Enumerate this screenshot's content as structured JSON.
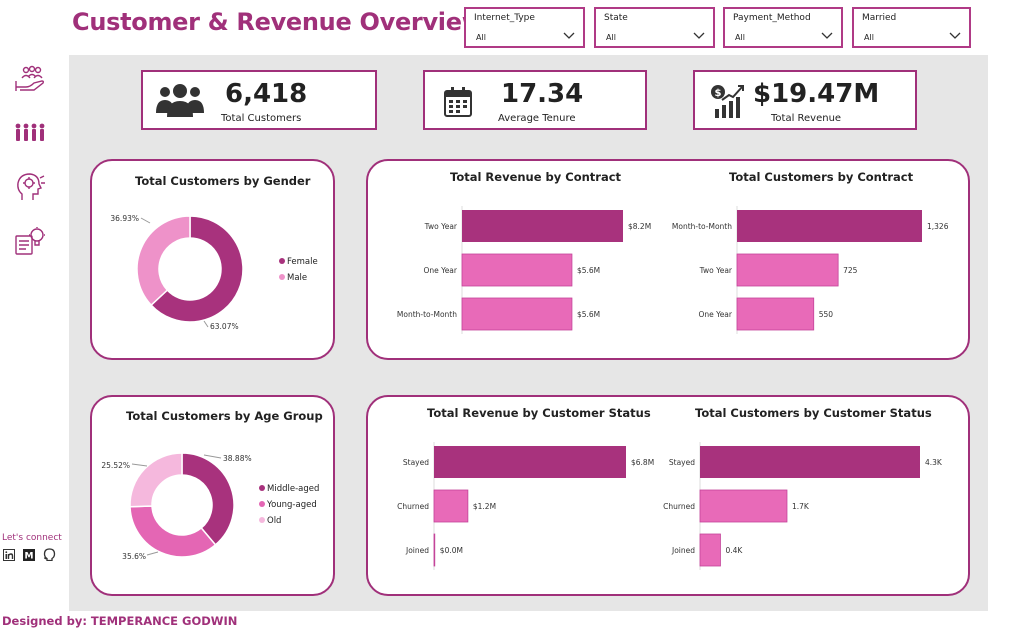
{
  "title": "Customer & Revenue Overview",
  "slicers": [
    {
      "label": "Internet_Type",
      "value": "All"
    },
    {
      "label": "State",
      "value": "All"
    },
    {
      "label": "Payment_Method",
      "value": "All"
    },
    {
      "label": "Married",
      "value": "All"
    }
  ],
  "nav_icons": [
    "customer-care-icon",
    "people-group-icon",
    "head-brain-icon",
    "insight-bulb-icon"
  ],
  "kpis": [
    {
      "value": "6,418",
      "caption": "Total Customers",
      "icon": "users-icon"
    },
    {
      "value": "17.34",
      "caption": "Average Tenure",
      "icon": "calendar-icon"
    },
    {
      "value": "$19.47M",
      "caption": "Total Revenue",
      "icon": "revenue-chart-icon"
    }
  ],
  "colors": {
    "accent": "#a0307a",
    "dark_bar": "#a8327d",
    "light_bar": "#e86ab8",
    "pale": "#f2b5dc"
  },
  "connect": {
    "label": "Let's connect",
    "icons": [
      "linkedin-icon",
      "medium-icon",
      "github-icon"
    ]
  },
  "footer": "Designed by: TEMPERANCE GODWIN",
  "chart_data": [
    {
      "type": "pie",
      "title": "Total Customers by Gender",
      "categories": [
        "Female",
        "Male"
      ],
      "values": [
        63.07,
        36.93
      ],
      "labels": [
        "63.07%",
        "36.93%"
      ],
      "colors": [
        "#a8327d",
        "#ee92c9"
      ],
      "legend": "right"
    },
    {
      "type": "bar",
      "title": "Total Revenue by Contract",
      "categories": [
        "Two Year",
        "One Year",
        "Month-to-Month"
      ],
      "values": [
        8.2,
        5.6,
        5.6
      ],
      "labels": [
        "$8.2M",
        "$5.6M",
        "$5.6M"
      ],
      "colors": [
        "#a8327d",
        "#e86ab8",
        "#e86ab8"
      ]
    },
    {
      "type": "bar",
      "title": "Total Customers by Contract",
      "categories": [
        "Month-to-Month",
        "Two Year",
        "One Year"
      ],
      "values": [
        1326,
        725,
        550
      ],
      "labels": [
        "1,326",
        "725",
        "550"
      ],
      "colors": [
        "#a8327d",
        "#e86ab8",
        "#e86ab8"
      ]
    },
    {
      "type": "pie",
      "title": "Total Customers by Age Group",
      "categories": [
        "Middle-aged",
        "Young-aged",
        "Old"
      ],
      "values": [
        38.88,
        35.6,
        25.52
      ],
      "labels": [
        "38.88%",
        "35.6%",
        "25.52%"
      ],
      "colors": [
        "#a8327d",
        "#e466b4",
        "#f5b8dd"
      ],
      "legend": "right"
    },
    {
      "type": "bar",
      "title": "Total Revenue by Customer Status",
      "categories": [
        "Stayed",
        "Churned",
        "Joined"
      ],
      "values": [
        6.8,
        1.2,
        0.0
      ],
      "labels": [
        "$6.8M",
        "$1.2M",
        "$0.0M"
      ],
      "colors": [
        "#a8327d",
        "#e86ab8",
        "#e86ab8"
      ]
    },
    {
      "type": "bar",
      "title": "Total Customers by Customer Status",
      "categories": [
        "Stayed",
        "Churned",
        "Joined"
      ],
      "values": [
        4.3,
        1.7,
        0.4
      ],
      "labels": [
        "4.3K",
        "1.7K",
        "0.4K"
      ],
      "colors": [
        "#a8327d",
        "#e86ab8",
        "#e86ab8"
      ]
    }
  ]
}
